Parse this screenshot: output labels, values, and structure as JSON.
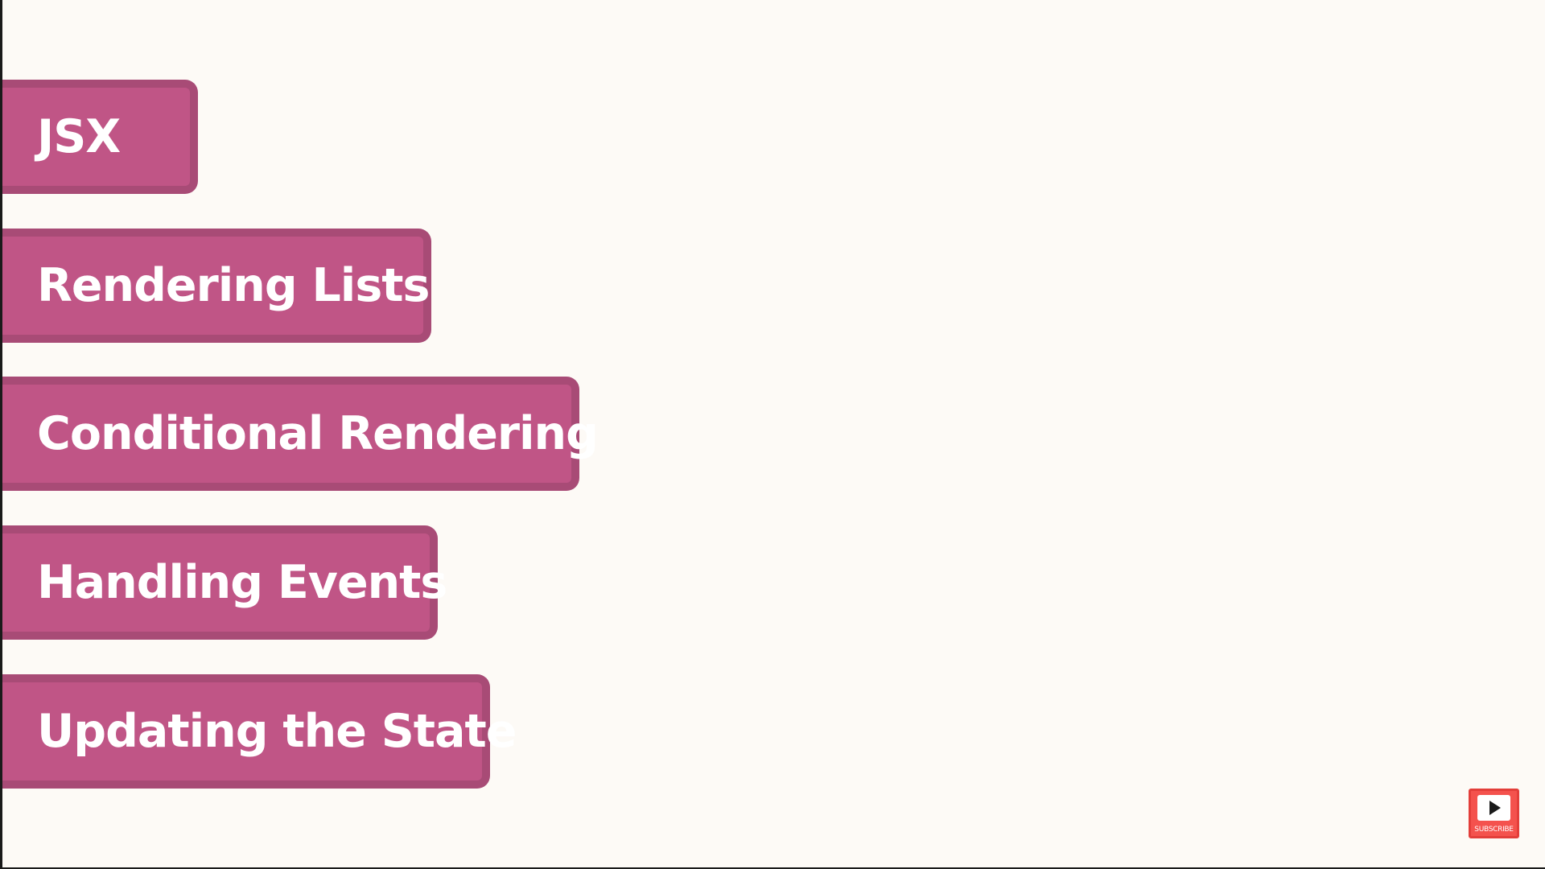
{
  "topics": [
    {
      "label": "JSX"
    },
    {
      "label": "Rendering Lists"
    },
    {
      "label": "Conditional Rendering"
    },
    {
      "label": "Handling Events"
    },
    {
      "label": "Updating the State"
    }
  ],
  "subscribe": {
    "label": "SUBSCRIBE",
    "icon": "play-icon"
  },
  "colors": {
    "background": "#fdfaf6",
    "topic_fill": "#c05586",
    "topic_border": "#a84b76",
    "subscribe": "#f4524d"
  }
}
